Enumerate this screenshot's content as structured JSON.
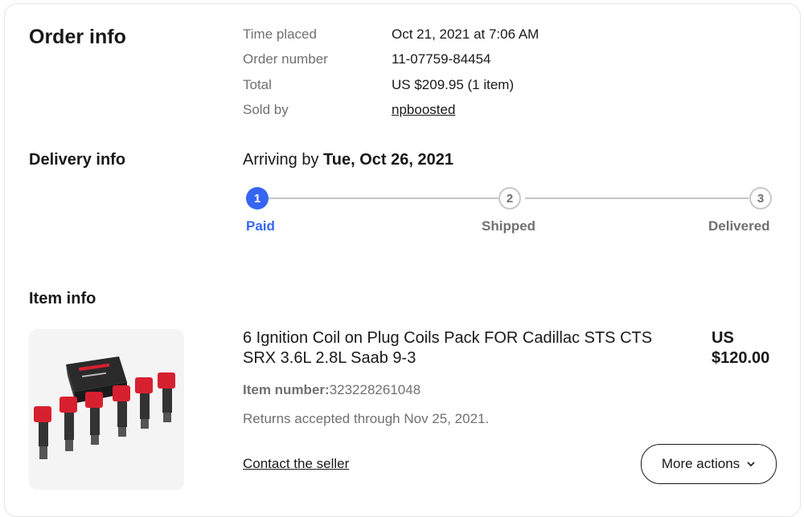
{
  "order": {
    "title": "Order info",
    "fields": [
      {
        "label": "Time placed",
        "value": "Oct 21, 2021 at 7:06 AM"
      },
      {
        "label": "Order number",
        "value": "11-07759-84454"
      },
      {
        "label": "Total",
        "value": "US $209.95 (1 item)"
      },
      {
        "label": "Sold by",
        "value": "npboosted"
      }
    ]
  },
  "delivery": {
    "title": "Delivery info",
    "arriving_prefix": "Arriving by",
    "arriving_date": "Tue, Oct 26, 2021",
    "steps": [
      {
        "number": "1",
        "label": "Paid",
        "done": true
      },
      {
        "number": "2",
        "label": "Shipped",
        "done": false
      },
      {
        "number": "3",
        "label": "Delivered",
        "done": false
      }
    ]
  },
  "item": {
    "title": "Item info",
    "name": "6 Ignition Coil on Plug Coils Pack FOR Cadillac STS CTS SRX 3.6L 2.8L Saab 9-3",
    "price_currency": "US",
    "price_amount": "$120.00",
    "item_number_label": "Item number:",
    "item_number": "323228261048",
    "returns": "Returns accepted through Nov 25, 2021.",
    "contact_link": "Contact the seller",
    "more_actions": "More actions"
  },
  "colors": {
    "accent": "#3665f3",
    "text_primary": "#191919",
    "text_secondary": "#707070",
    "track_inactive": "#c7c7c7",
    "product_red": "#d7202f"
  }
}
